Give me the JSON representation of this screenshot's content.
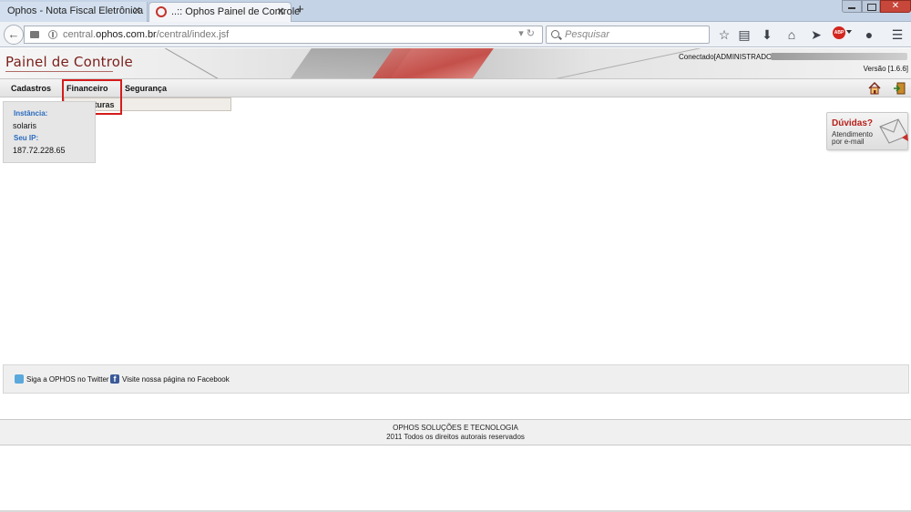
{
  "browser": {
    "tabs": [
      {
        "label": "Ophos - Nota Fiscal Eletrônica",
        "active": false
      },
      {
        "label": "..:: Ophos Painel de Controle",
        "active": true
      }
    ],
    "url_prefix": "central.",
    "url_domain": "ophos.com.br",
    "url_path": "/central/index.jsf",
    "search_placeholder": "Pesquisar",
    "abp_label": "ABP",
    "accent_color": "#c4332b"
  },
  "header": {
    "brand": "Painel de Controle",
    "connected": "Conectado[ADMINISTRADOR",
    "version": "Versão [1.6.6]"
  },
  "menu": {
    "items": [
      "Cadastros",
      "Financeiro",
      "Segurança"
    ],
    "dropdown": [
      "Faturas"
    ]
  },
  "info": {
    "instance_label": "Instância:",
    "instance_value": "solaris",
    "ip_label": "Seu IP:",
    "ip_value": "187.72.228.65"
  },
  "help": {
    "title": "Dúvidas?",
    "line1": "Atendimento",
    "line2": "por e-mail"
  },
  "social": {
    "twitter": "Siga a OPHOS no Twitter",
    "facebook": "Visite nossa página no Facebook"
  },
  "footer": {
    "company": "OPHOS SOLUÇÕES E TECNOLOGIA",
    "rights": "2011 Todos os direitos autorais reservados"
  }
}
